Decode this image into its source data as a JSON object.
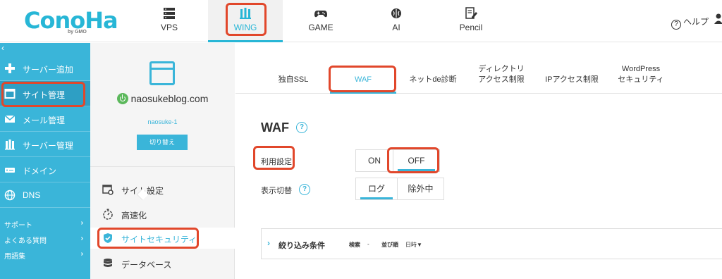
{
  "header": {
    "logo_text": "ConoHa",
    "logo_sub": "by GMO",
    "services": [
      {
        "label": "VPS",
        "icon": "server-icon"
      },
      {
        "label": "WING",
        "icon": "wing-icon",
        "active": true
      },
      {
        "label": "GAME",
        "icon": "gamepad-icon"
      },
      {
        "label": "AI",
        "icon": "brain-icon"
      },
      {
        "label": "Pencil",
        "icon": "pencil-icon"
      }
    ],
    "help_label": "ヘルプ"
  },
  "sidebar": {
    "collapse": "‹",
    "items": [
      {
        "label": "サーバー追加",
        "icon": "plus-icon"
      },
      {
        "label": "サイト管理",
        "icon": "window-icon",
        "active": true
      },
      {
        "label": "メール管理",
        "icon": "mail-icon"
      },
      {
        "label": "サーバー管理",
        "icon": "server-manage-icon"
      },
      {
        "label": "ドメイン",
        "icon": "domain-icon"
      },
      {
        "label": "DNS",
        "icon": "globe-icon"
      }
    ],
    "links": [
      {
        "label": "サポート",
        "arrow": "›"
      },
      {
        "label": "よくある質問",
        "arrow": "›"
      },
      {
        "label": "用語集",
        "arrow": "›"
      }
    ]
  },
  "site_panel": {
    "domain": "naosukeblog.com",
    "account": "naosuke-1",
    "switch_label": "切り替え",
    "menu": [
      {
        "label": "サイト設定",
        "icon": "site-settings-icon"
      },
      {
        "label": "高速化",
        "icon": "stopwatch-icon"
      },
      {
        "label": "サイトセキュリティ",
        "icon": "shield-icon",
        "active": true
      },
      {
        "label": "データベース",
        "icon": "database-icon"
      }
    ]
  },
  "main": {
    "tabs": [
      {
        "line1": "",
        "line2": "独自SSL"
      },
      {
        "line1": "",
        "line2": "WAF",
        "active": true
      },
      {
        "line1": "",
        "line2": "ネットde診断"
      },
      {
        "line1": "ディレクトリ",
        "line2": "アクセス制限"
      },
      {
        "line1": "",
        "line2": "IPアクセス制限"
      },
      {
        "line1": "WordPress",
        "line2": "セキュリティ"
      }
    ],
    "title": "WAF",
    "help_icon": "?",
    "usage_label": "利用設定",
    "usage_options": [
      "ON",
      "OFF"
    ],
    "usage_selected": "OFF",
    "display_label": "表示切替",
    "display_options": [
      "ログ",
      "除外中"
    ],
    "display_selected": "ログ",
    "filter": {
      "chevron": "›",
      "title": "絞り込み条件",
      "search_label": "検索",
      "search_value": "-",
      "sort_label": "並び順",
      "sort_value": "日時▼"
    }
  },
  "colors": {
    "accent": "#3ab5d9",
    "annotation_red": "#e1472b",
    "power_green": "#5cb85c"
  }
}
